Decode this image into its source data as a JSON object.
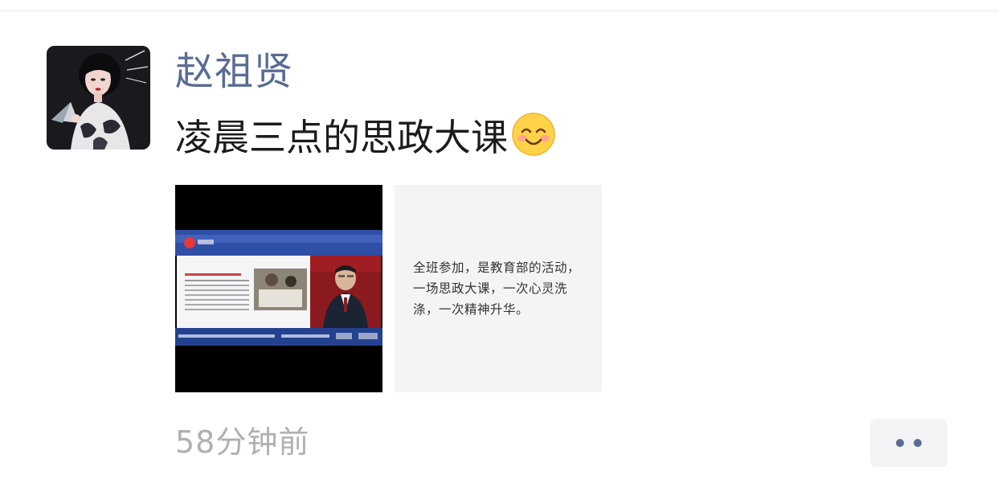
{
  "post": {
    "author": "赵祖贤",
    "content": "凌晨三点的思政大课",
    "content_emoji": "smiling-face-icon",
    "images": [
      {
        "kind": "video-screenshot",
        "description_icon": "news-broadcast-thumbnail"
      },
      {
        "kind": "text-card",
        "text": "全班参加，是教育部的活动，一场思政大课，一次心灵洗涤，一次精神升华。"
      }
    ],
    "time": "58分钟前",
    "more_icon": "more-dots-icon"
  },
  "colors": {
    "author_name": "#5a6c93",
    "body_text": "#1c1c1c",
    "timestamp": "#b0b0b0",
    "more_button_bg": "#f3f3f5"
  }
}
